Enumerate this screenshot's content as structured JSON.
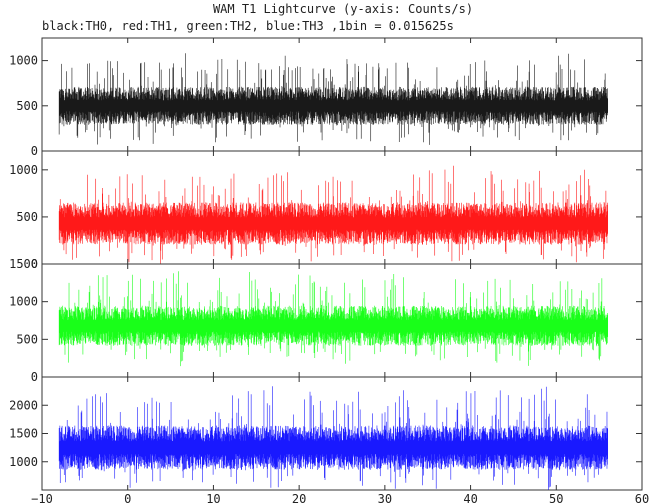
{
  "chart_data": {
    "type": "line",
    "title": "WAM T1 Lightcurve (y-axis: Counts/s)",
    "subtitle": "black:TH0, red:TH1, green:TH2, blue:TH3 ,1bin = 0.015625s",
    "xlabel": "",
    "ylabel": "",
    "xlim": [
      -10,
      60
    ],
    "x_ticks": [
      -10,
      0,
      10,
      20,
      30,
      40,
      50,
      60
    ],
    "x_tick_labels": [
      "−10",
      "0",
      "10",
      "20",
      "30",
      "40",
      "50",
      "60"
    ],
    "x_range_of_data": [
      -8,
      56
    ],
    "bin_seconds": 0.015625,
    "grid": false,
    "series": [
      {
        "color": "#000000",
        "ylim": [
          0,
          1250
        ],
        "y_ticks": [
          0,
          500,
          1000
        ],
        "y_tick_labels": [
          "0",
          "500",
          "1000"
        ],
        "base": 500,
        "band": 150,
        "spike": 400
      },
      {
        "color": "#ff0000",
        "ylim": [
          0,
          1200
        ],
        "y_ticks": [
          0,
          500,
          1000
        ],
        "y_tick_labels": [
          "0",
          "500",
          "1000"
        ],
        "base": 430,
        "band": 160,
        "spike": 420
      },
      {
        "color": "#00ff00",
        "ylim": [
          0,
          1500
        ],
        "y_ticks": [
          0,
          500,
          1000,
          1500
        ],
        "y_tick_labels": [
          "0",
          "500",
          "1000",
          "1500"
        ],
        "base": 680,
        "band": 190,
        "spike": 500
      },
      {
        "color": "#0000ff",
        "ylim": [
          500,
          2500
        ],
        "y_ticks": [
          1000,
          1500,
          2000
        ],
        "y_tick_labels": [
          "1000",
          "1500",
          "2000"
        ],
        "base": 1250,
        "band": 280,
        "spike": 750
      }
    ]
  }
}
